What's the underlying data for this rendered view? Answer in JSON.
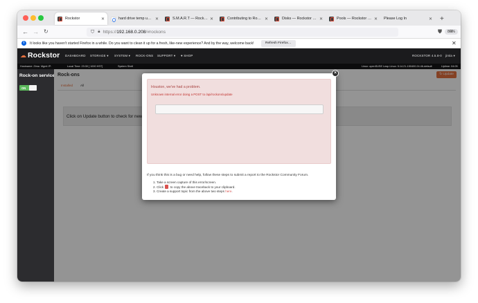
{
  "browser": {
    "tabs": [
      {
        "title": "Rockstor",
        "active": true
      },
      {
        "title": "hard drive temp under Li"
      },
      {
        "title": "S.M.A.R.T — Rockstor d"
      },
      {
        "title": "Contributing to Rockstor"
      },
      {
        "title": "Disks — Rockstor docu"
      },
      {
        "title": "Pools — Rockstor docu"
      },
      {
        "title": "Please Log In"
      }
    ],
    "new_tab": "+",
    "url_host": "192.168.0.208",
    "url_scheme": "https://",
    "url_path": "/#rockons",
    "zoom": "80%"
  },
  "notification": {
    "text": "It looks like you haven't started Firefox in a while. Do you want to clean it up for a fresh, like-new experience? And by the way, welcome back!",
    "button": "Refresh Firefox…",
    "info_glyph": "i"
  },
  "app": {
    "logo": "Rockstor",
    "menu": [
      {
        "label": "DASHBOARD"
      },
      {
        "label": "STORAGE ▾"
      },
      {
        "label": "SYSTEM ▾"
      },
      {
        "label": "ROCK-ONS"
      },
      {
        "label": "SUPPORT ▾"
      },
      {
        "label": "♥ SHOP"
      }
    ],
    "version": "ROCKSTOR 4.5.8-0",
    "user": "jimla ▾",
    "info": {
      "hostname": "Hostname: Zima",
      "mgmt_ip": "Mgmt IP:",
      "local_time": "Local Time: 23:30 [ 1000 HST]",
      "system_shell": "System Shell",
      "os": "Linux: openSUSE Leap  Linux: 5.14.21-150400.24.46-default",
      "uptime": "Uptime: 04:05"
    }
  },
  "sidebar": {
    "title": "Rock-on service",
    "toggle_label": "ON"
  },
  "main": {
    "title": "Rock-ons",
    "update_button": "↻ Update",
    "tabs": [
      {
        "label": "Installed",
        "active": true
      },
      {
        "label": "All"
      }
    ],
    "panel_text": "Click on Update button to check for new R"
  },
  "modal": {
    "error_title": "Houston, we've had a problem.",
    "error_message": "Unknown internal error doing a POST to /api/rockons/update",
    "help_text": "If you think this is a bug or need help, follow these steps to submit a report to the Rockstor Community Forum.",
    "step1": "1. Take a screen capture of this error/screen.",
    "step2_pre": "2. Click",
    "step2_post": "to copy the above traceback to your clipboard.",
    "step3_pre": "3. Create a support topic from the above two steps",
    "step3_link": "here",
    "step3_post": ".",
    "close": "×"
  },
  "colors": {
    "accent": "#e4703f",
    "error_bg": "#f1dede",
    "error_text": "#a94442",
    "toggle_on": "#5cb85c",
    "header_bg": "#1b1b1d"
  }
}
